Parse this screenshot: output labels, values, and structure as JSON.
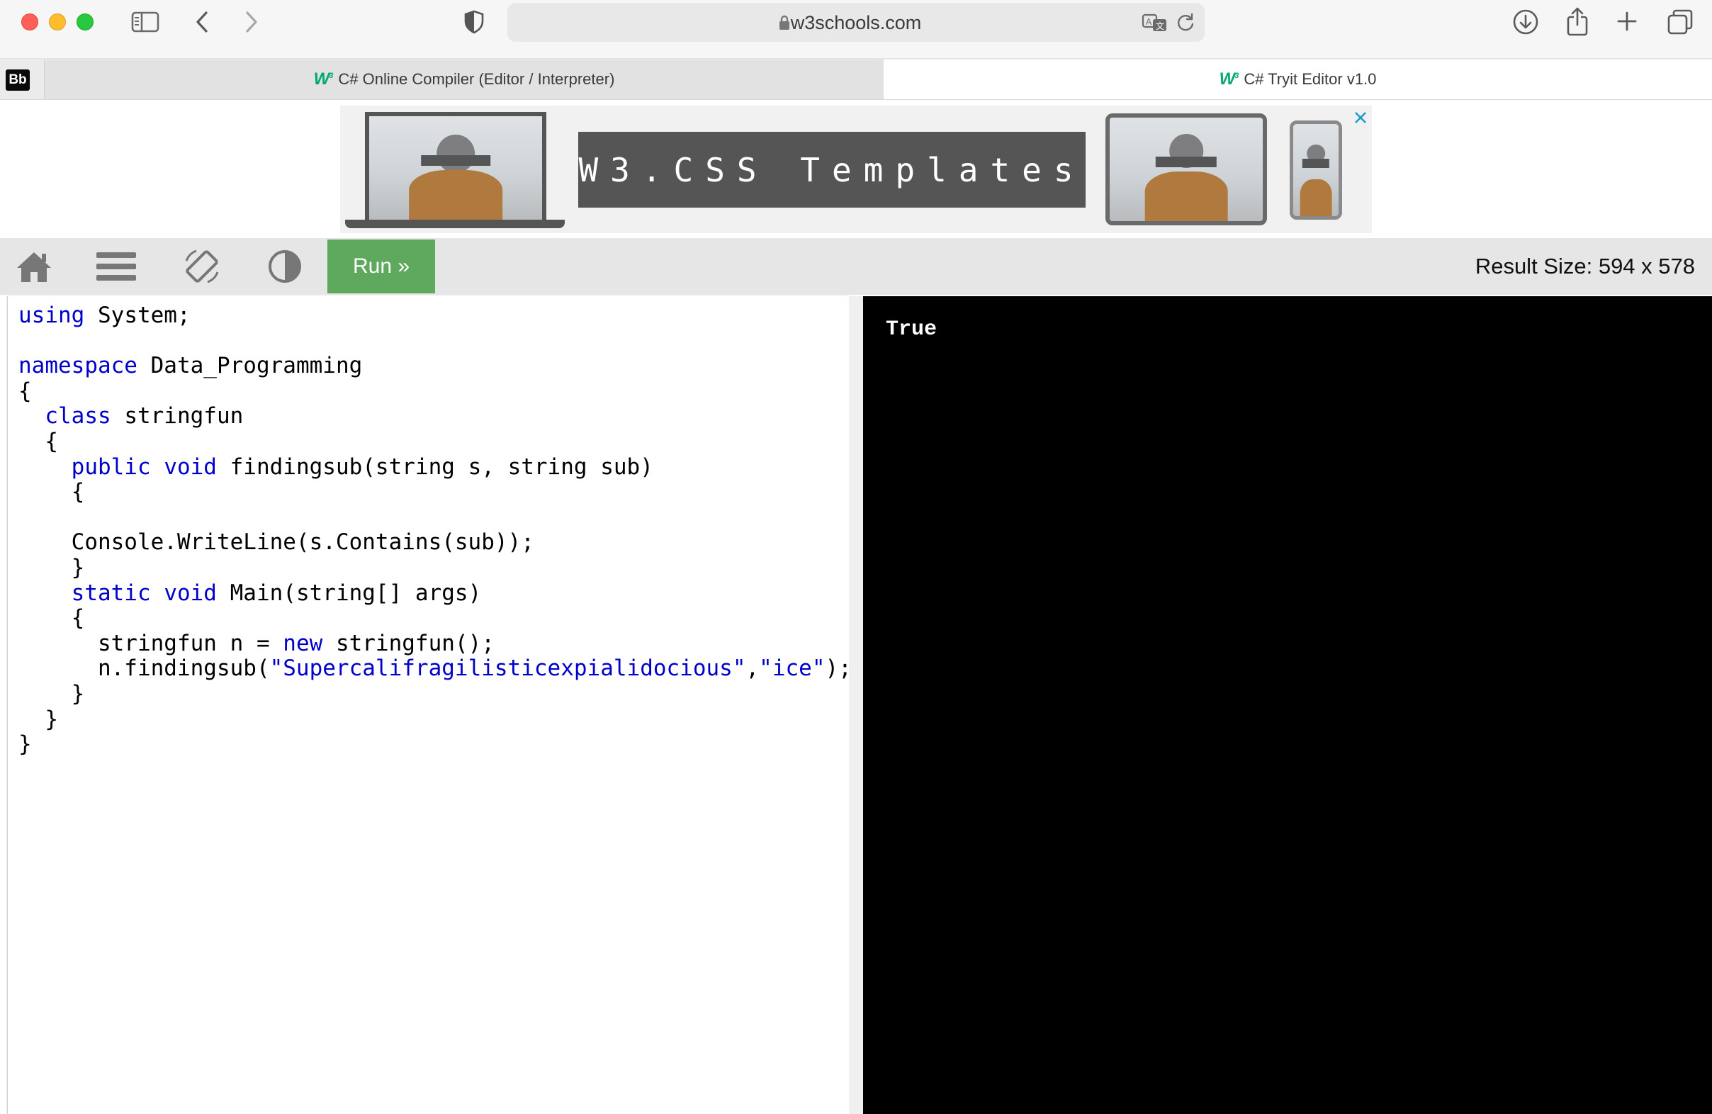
{
  "browser": {
    "url": "w3schools.com"
  },
  "tabs": [
    {
      "label": "C# Online Compiler (Editor / Interpreter)",
      "favicon": "W3"
    },
    {
      "label": "C# Tryit Editor v1.0",
      "favicon": "W3"
    }
  ],
  "pinned_tab": {
    "label": "Bb"
  },
  "ad": {
    "headline": "W3.CSS Templates",
    "close_icon": "close-x-icon"
  },
  "editor_toolbar": {
    "run_label": "Run »",
    "result_size_label": "Result Size: 594 x 578",
    "icons": [
      "home-icon",
      "menu-icon",
      "rotate-icon",
      "contrast-icon"
    ]
  },
  "code": {
    "lines": [
      "using System;",
      "",
      "namespace Data_Programming",
      "{",
      "  class stringfun",
      "  {",
      "    public void findingsub(string s, string sub)",
      "    {",
      "",
      "    Console.WriteLine(s.Contains(sub));",
      "    }",
      "    static void Main(string[] args)",
      "    {",
      "      stringfun n = new stringfun();",
      "      n.findingsub(\"Supercalifragilisticexpialidocious\",\"ice\");",
      "    }",
      "  }",
      "}"
    ]
  },
  "output": {
    "text": "True"
  },
  "colors": {
    "run_button": "#5fa95f",
    "keyword": "#0000cd",
    "output_bg": "#000000"
  }
}
